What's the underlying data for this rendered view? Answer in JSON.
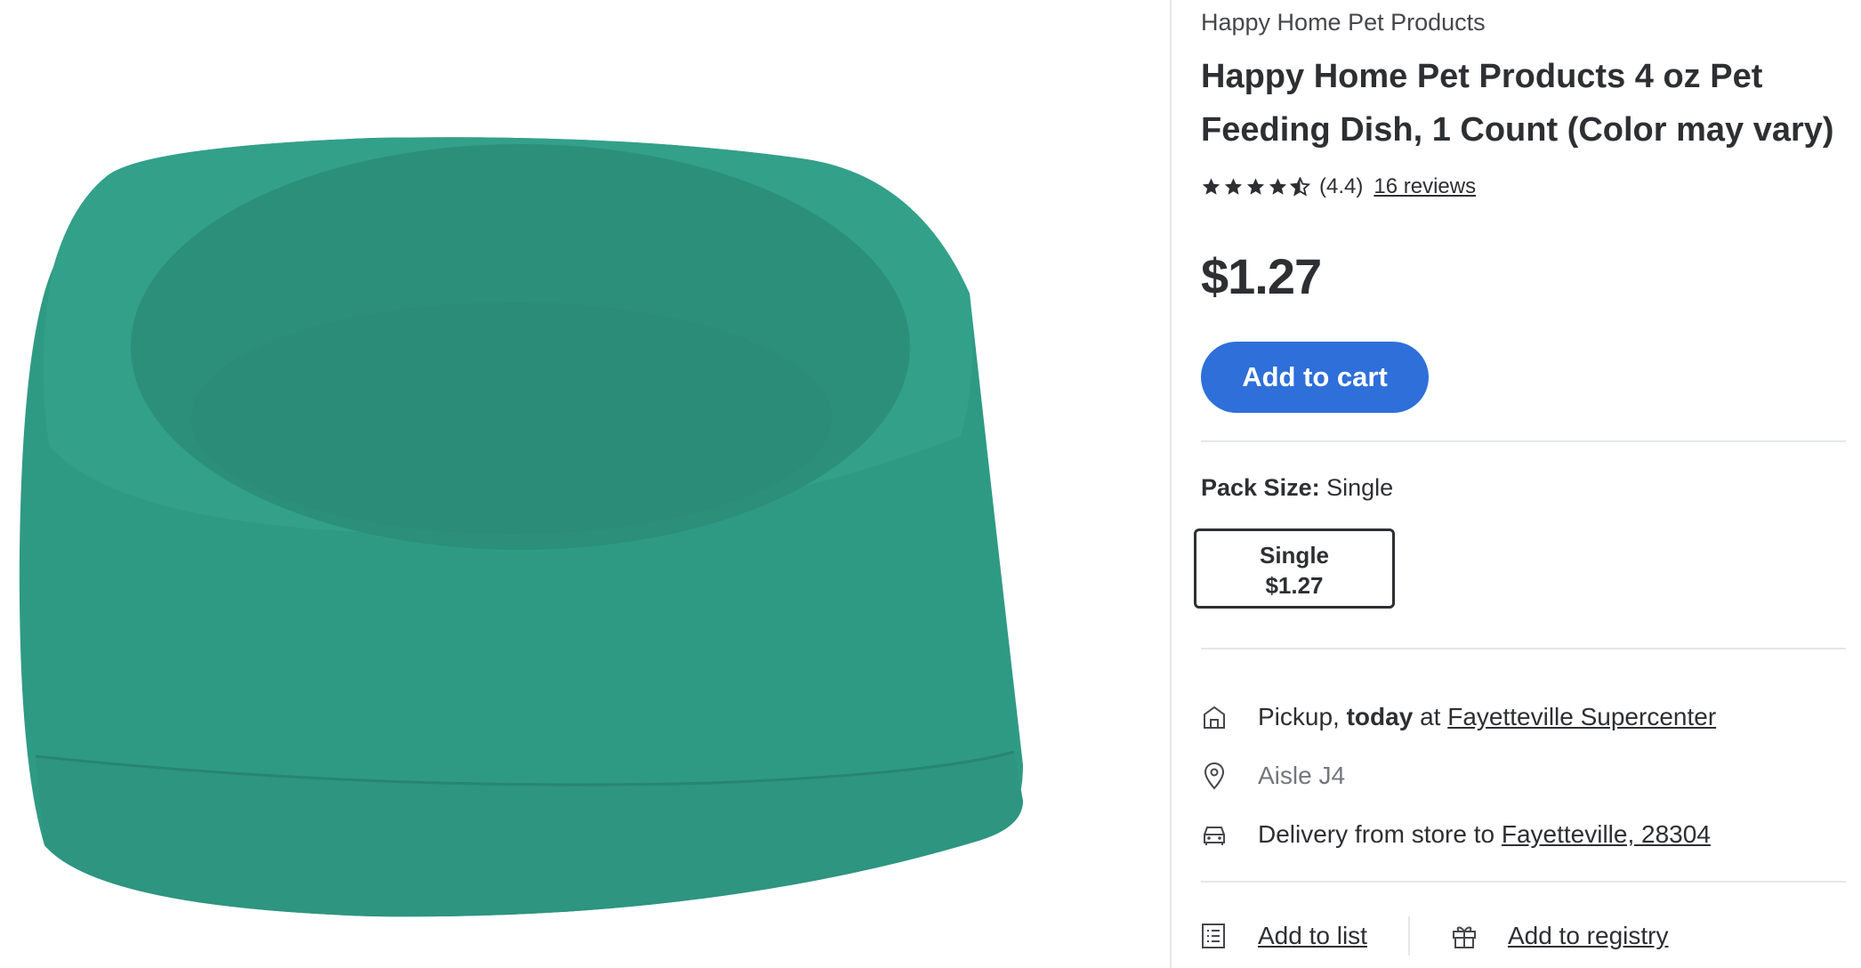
{
  "product": {
    "brand": "Happy Home Pet Products",
    "title": "Happy Home Pet Products 4 oz Pet Feeding Dish, 1 Count (Color may vary)",
    "image_alt_color": "#2f9a84"
  },
  "rating": {
    "value": 4.4,
    "value_text": "(4.4)",
    "reviews_text": "16 reviews",
    "star_icons": [
      "star-full",
      "star-full",
      "star-full",
      "star-full",
      "star-half"
    ]
  },
  "price": "$1.27",
  "add_to_cart": "Add to cart",
  "accent_color": "#2e6fd9",
  "pack_size": {
    "label": "Pack Size:",
    "selected": "Single",
    "options": [
      {
        "name": "Single",
        "price": "$1.27"
      }
    ]
  },
  "fulfillment": {
    "pickup_prefix": "Pickup,",
    "pickup_when": "today",
    "pickup_at": "at",
    "pickup_store": "Fayetteville Supercenter",
    "aisle": "Aisle J4",
    "delivery_prefix": "Delivery from store to",
    "delivery_location": "Fayetteville, 28304"
  },
  "actions": {
    "add_to_list": "Add to list",
    "add_to_registry": "Add to registry"
  }
}
